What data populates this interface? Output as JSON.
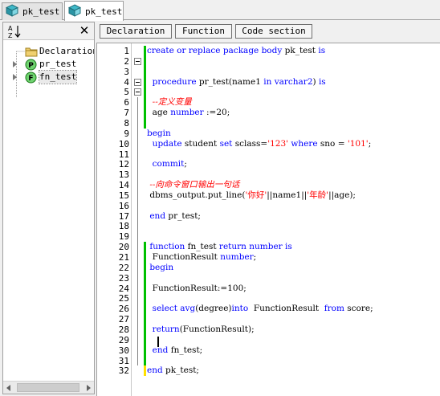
{
  "tabs": [
    {
      "label": "pk_test",
      "icon": "package-icon",
      "active": false
    },
    {
      "label": "pk_test",
      "icon": "package-icon",
      "active": true
    }
  ],
  "left_panel": {
    "sort_icon": "sort-az-icon",
    "close_glyph": "✕",
    "tree": [
      {
        "label": "Declaration",
        "icon": "folder-icon",
        "expandable": false
      },
      {
        "label": "pr_test",
        "icon": "procedure-icon",
        "icon_letter": "P",
        "expandable": true
      },
      {
        "label": "fn_test",
        "icon": "function-icon",
        "icon_letter": "F",
        "expandable": true
      }
    ]
  },
  "toolbar": {
    "declaration_label": "Declaration",
    "function_label": "Function",
    "code_section_label": "Code section"
  },
  "editor": {
    "current_line": 29,
    "lines": [
      {
        "no": "1",
        "tokens": [
          {
            "t": "create or replace package body ",
            "c": "kw"
          },
          {
            "t": "pk_test ",
            "c": "id"
          },
          {
            "t": "is",
            "c": "kw"
          }
        ]
      },
      {
        "no": "2",
        "tokens": []
      },
      {
        "no": "3",
        "tokens": []
      },
      {
        "no": "4",
        "tokens": [
          {
            "t": "  procedure ",
            "c": "kw"
          },
          {
            "t": "pr_test(name1 ",
            "c": "id"
          },
          {
            "t": "in varchar2",
            "c": "kw"
          },
          {
            "t": ") ",
            "c": "id"
          },
          {
            "t": "is",
            "c": "kw"
          }
        ]
      },
      {
        "no": "5",
        "tokens": []
      },
      {
        "no": "6",
        "tokens": [
          {
            "t": "  --定义变量",
            "c": "cmt"
          }
        ]
      },
      {
        "no": "7",
        "tokens": [
          {
            "t": "  age ",
            "c": "id"
          },
          {
            "t": "number ",
            "c": "kw"
          },
          {
            "t": ":=20;",
            "c": "id"
          }
        ]
      },
      {
        "no": "8",
        "tokens": []
      },
      {
        "no": "9",
        "tokens": [
          {
            "t": "begin",
            "c": "kw"
          }
        ]
      },
      {
        "no": "10",
        "tokens": [
          {
            "t": "  update ",
            "c": "kw"
          },
          {
            "t": "student ",
            "c": "id"
          },
          {
            "t": "set ",
            "c": "kw"
          },
          {
            "t": "sclass=",
            "c": "id"
          },
          {
            "t": "'123'",
            "c": "str"
          },
          {
            "t": " where ",
            "c": "kw"
          },
          {
            "t": "sno = ",
            "c": "id"
          },
          {
            "t": "'101'",
            "c": "str"
          },
          {
            "t": ";",
            "c": "id"
          }
        ]
      },
      {
        "no": "11",
        "tokens": []
      },
      {
        "no": "12",
        "tokens": [
          {
            "t": "  commit",
            "c": "kw"
          },
          {
            "t": ";",
            "c": "id"
          }
        ]
      },
      {
        "no": "13",
        "tokens": []
      },
      {
        "no": "14",
        "tokens": [
          {
            "t": " --向命令窗口输出一句话",
            "c": "cmt"
          }
        ]
      },
      {
        "no": "15",
        "tokens": [
          {
            "t": " dbms_output.put_line(",
            "c": "id"
          },
          {
            "t": "'你好'",
            "c": "str"
          },
          {
            "t": "||name1||",
            "c": "id"
          },
          {
            "t": "'年龄'",
            "c": "str"
          },
          {
            "t": "||age);",
            "c": "id"
          }
        ]
      },
      {
        "no": "16",
        "tokens": []
      },
      {
        "no": "17",
        "tokens": [
          {
            "t": " end ",
            "c": "kw"
          },
          {
            "t": "pr_test;",
            "c": "id"
          }
        ]
      },
      {
        "no": "18",
        "tokens": []
      },
      {
        "no": "19",
        "tokens": []
      },
      {
        "no": "20",
        "tokens": [
          {
            "t": " function ",
            "c": "kw"
          },
          {
            "t": "fn_test ",
            "c": "id"
          },
          {
            "t": "return number is",
            "c": "kw"
          }
        ]
      },
      {
        "no": "21",
        "tokens": [
          {
            "t": "  FunctionResult ",
            "c": "id"
          },
          {
            "t": "number",
            "c": "kw"
          },
          {
            "t": ";",
            "c": "id"
          }
        ]
      },
      {
        "no": "22",
        "tokens": [
          {
            "t": " begin",
            "c": "kw"
          }
        ]
      },
      {
        "no": "23",
        "tokens": []
      },
      {
        "no": "24",
        "tokens": [
          {
            "t": "  FunctionResult:=100;",
            "c": "id"
          }
        ]
      },
      {
        "no": "25",
        "tokens": []
      },
      {
        "no": "26",
        "tokens": [
          {
            "t": "  select avg",
            "c": "kw"
          },
          {
            "t": "(degree)",
            "c": "id"
          },
          {
            "t": "into",
            "c": "kw"
          },
          {
            "t": "  FunctionResult  ",
            "c": "id"
          },
          {
            "t": "from ",
            "c": "kw"
          },
          {
            "t": "score;",
            "c": "id"
          }
        ]
      },
      {
        "no": "27",
        "tokens": []
      },
      {
        "no": "28",
        "tokens": [
          {
            "t": "  return",
            "c": "kw"
          },
          {
            "t": "(FunctionResult);",
            "c": "id"
          }
        ]
      },
      {
        "no": "29",
        "tokens": []
      },
      {
        "no": "30",
        "tokens": [
          {
            "t": "  end ",
            "c": "kw"
          },
          {
            "t": "fn_test;",
            "c": "id"
          }
        ]
      },
      {
        "no": "31",
        "tokens": []
      },
      {
        "no": "32",
        "tokens": [
          {
            "t": "end ",
            "c": "kw"
          },
          {
            "t": "pk_test;",
            "c": "id"
          }
        ]
      }
    ]
  },
  "colors": {
    "keyword": "#0000ff",
    "string": "#ff0000",
    "comment": "#ff0000",
    "changed_saved": "#00c000",
    "changed_unsaved": "#ffe000"
  }
}
